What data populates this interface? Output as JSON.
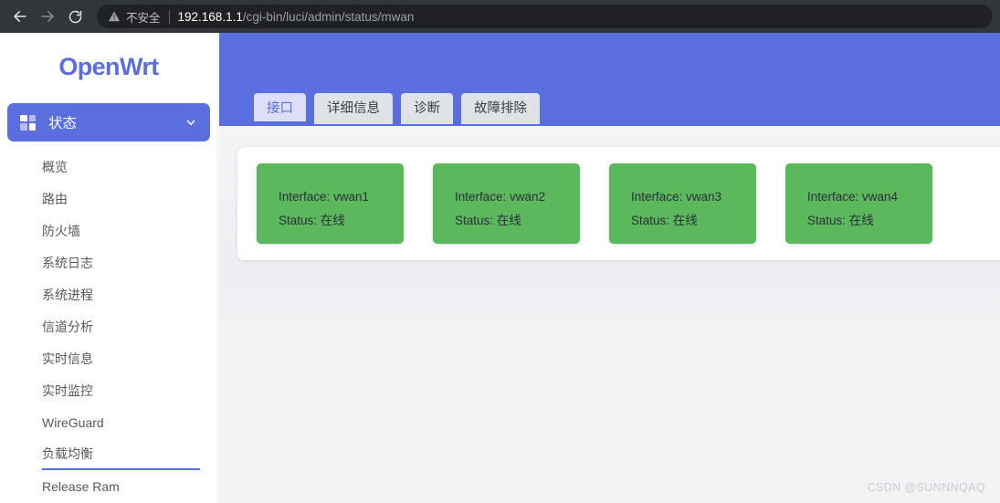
{
  "browser": {
    "back_icon": "back-arrow-icon",
    "forward_icon": "forward-arrow-icon",
    "reload_icon": "reload-icon",
    "security_icon": "warning-triangle-icon",
    "security_label": "不安全",
    "url_host": "192.168.1.1",
    "url_path": "/cgi-bin/luci/admin/status/mwan",
    "chrome_bg": "#323639",
    "omnibox_bg": "#202124"
  },
  "sidebar": {
    "logo": "OpenWrt",
    "accent": "#5b6ee0",
    "active_group": {
      "label": "状态",
      "icon": "grid-dashboard-icon",
      "chevron": "chevron-down-icon"
    },
    "items": [
      {
        "label": "概览",
        "current": false
      },
      {
        "label": "路由",
        "current": false
      },
      {
        "label": "防火墙",
        "current": false
      },
      {
        "label": "系统日志",
        "current": false
      },
      {
        "label": "系统进程",
        "current": false
      },
      {
        "label": "信道分析",
        "current": false
      },
      {
        "label": "实时信息",
        "current": false
      },
      {
        "label": "实时监控",
        "current": false
      },
      {
        "label": "WireGuard",
        "current": false
      },
      {
        "label": "负载均衡",
        "current": true
      },
      {
        "label": "Release Ram",
        "current": false
      }
    ]
  },
  "main": {
    "header_bg": "#5b6ee0",
    "tabs": [
      {
        "label": "接口",
        "active": true
      },
      {
        "label": "详细信息",
        "active": false
      },
      {
        "label": "诊断",
        "active": false
      },
      {
        "label": "故障排除",
        "active": false
      }
    ],
    "status_color": "#5cb85c",
    "interfaces": [
      {
        "interface_label": "Interface: vwan1",
        "status_label": "Status: 在线"
      },
      {
        "interface_label": "Interface: vwan2",
        "status_label": "Status: 在线"
      },
      {
        "interface_label": "Interface: vwan3",
        "status_label": "Status: 在线"
      },
      {
        "interface_label": "Interface: vwan4",
        "status_label": "Status: 在线"
      }
    ]
  },
  "watermark": "CSDN @SUNNNQAQ"
}
